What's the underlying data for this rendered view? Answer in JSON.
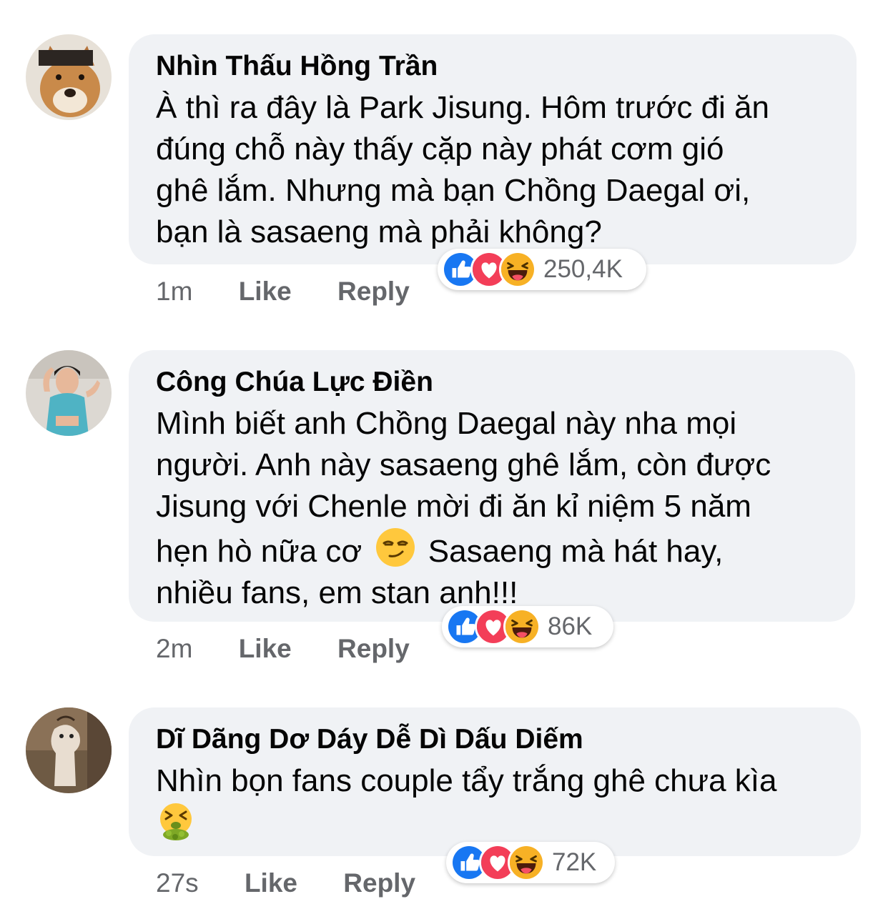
{
  "colors": {
    "bubble_bg": "#f0f2f5",
    "meta_text": "#65676b",
    "like_blue": "#1877f2",
    "love_red": "#f33e58",
    "haha_yellow": "#f7b125"
  },
  "comments": [
    {
      "author": "Nhìn Thấu Hồng Trần",
      "text_lines": [
        "À thì ra đây là Park Jisung. Hôm trước đi ăn",
        "đúng chỗ này thấy cặp này phát cơm gió",
        "ghê lắm. Nhưng mà bạn Chồng Daegal ơi,",
        "bạn là sasaeng mà phải không?"
      ],
      "time": "1m",
      "like_label": "Like",
      "reply_label": "Reply",
      "reaction_icons": [
        "like-icon",
        "love-icon",
        "haha-icon"
      ],
      "reaction_count": "250,4K"
    },
    {
      "author": "Công Chúa Lực Điền",
      "text_lines": [
        "Mình biết anh Chồng Daegal này nha mọi",
        "người. Anh này sasaeng ghê lắm, còn được",
        "Jisung với Chenle mời đi ăn kỉ niệm 5 năm",
        "hẹn hò nữa cơ",
        "Sasaeng mà hát hay,",
        "nhiều fans, em stan anh!!!"
      ],
      "inline_emoji": "smirk-emoji",
      "time": "2m",
      "like_label": "Like",
      "reply_label": "Reply",
      "reaction_icons": [
        "like-icon",
        "love-icon",
        "haha-icon"
      ],
      "reaction_count": "86K"
    },
    {
      "author": "Dĩ Dãng Dơ Dáy Dễ Dì Dấu Diếm",
      "text_lines": [
        "Nhìn bọn fans couple tẩy trắng ghê chưa kìa"
      ],
      "inline_emoji": "vomiting-face-emoji",
      "time": "27s",
      "like_label": "Like",
      "reply_label": "Reply",
      "reaction_icons": [
        "like-icon",
        "love-icon",
        "haha-icon"
      ],
      "reaction_count": "72K"
    }
  ]
}
